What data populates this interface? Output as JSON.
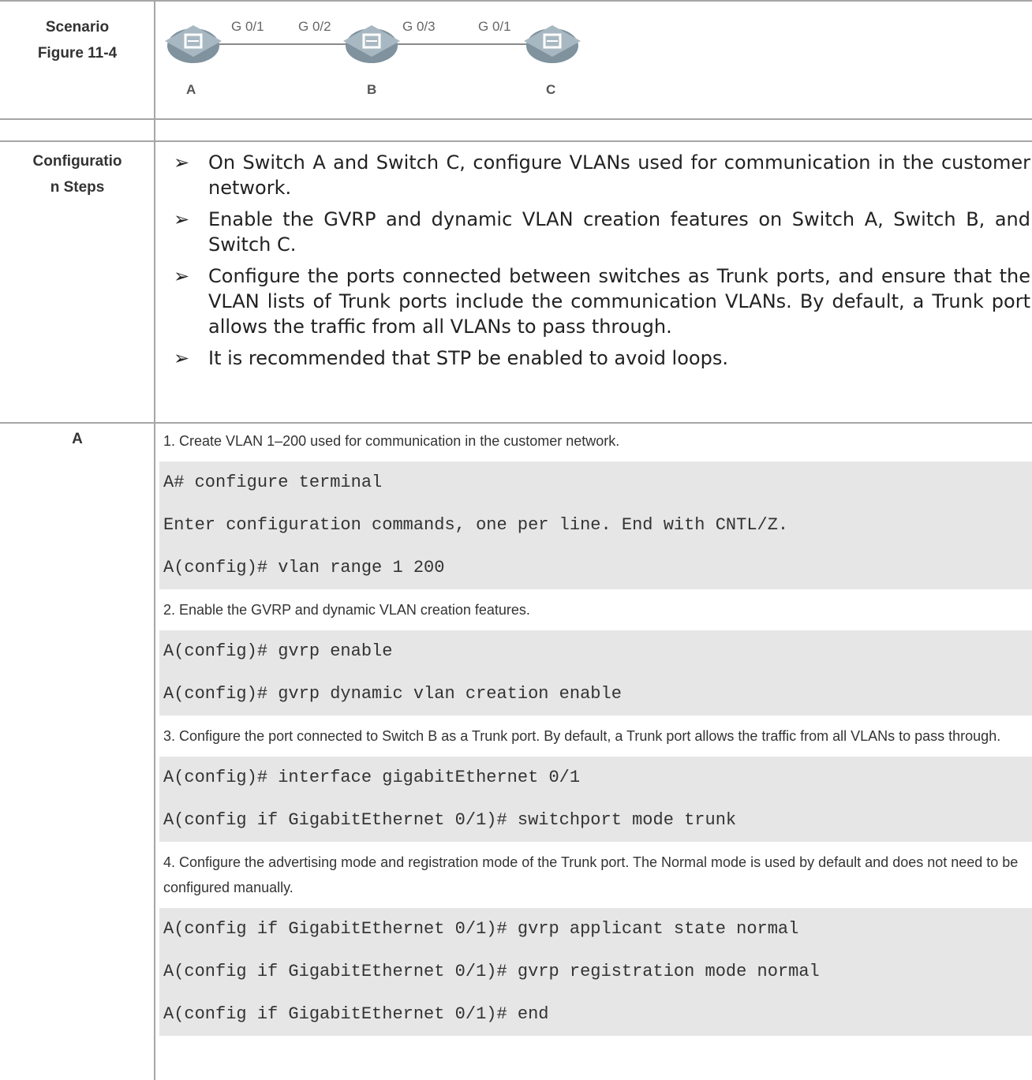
{
  "scenario": {
    "label_line1": "Scenario",
    "label_line2": "Figure 11-4",
    "devices": [
      "A",
      "B",
      "C"
    ],
    "ports": [
      "G 0/1",
      "G 0/2",
      "G 0/3",
      "G 0/1"
    ]
  },
  "config": {
    "label_line1": "Configuratio",
    "label_line2": "n Steps",
    "bullet": "➢",
    "steps": [
      "On Switch A and Switch C, configure VLANs used for communication in the customer network.",
      "Enable the GVRP and dynamic VLAN creation features on Switch A, Switch B, and Switch C.",
      "Configure the ports connected between switches as Trunk ports, and ensure that the VLAN lists of Trunk ports include the communication VLANs. By default, a Trunk port allows the traffic from all VLANs to pass through.",
      "It is recommended that STP be enabled to avoid loops."
    ]
  },
  "device_a": {
    "label": "A",
    "blocks": [
      {
        "note": "1. Create VLAN 1–200 used for communication in the customer network.",
        "lines": [
          "A# configure terminal",
          "Enter configuration commands, one per line. End with CNTL/Z.",
          "A(config)# vlan range 1 200"
        ]
      },
      {
        "note": "2. Enable the GVRP and dynamic VLAN creation features.",
        "lines": [
          "A(config)# gvrp enable",
          "A(config)# gvrp dynamic vlan creation enable"
        ]
      },
      {
        "note": "3. Configure the port connected to Switch B as a Trunk port. By default, a Trunk port allows the traffic from all VLANs to pass through.",
        "lines": [
          "A(config)# interface gigabitEthernet 0/1",
          "A(config if GigabitEthernet 0/1)# switchport mode trunk"
        ]
      },
      {
        "note": "4. Configure the advertising mode and registration mode of the Trunk port. The Normal mode is used by default and does not need to be configured manually.",
        "lines": [
          "A(config if GigabitEthernet 0/1)# gvrp applicant state normal",
          "A(config if GigabitEthernet 0/1)# gvrp registration mode normal",
          "A(config if GigabitEthernet 0/1)# end"
        ]
      }
    ]
  },
  "colors": {
    "border": "#a6a6a6",
    "code_bg": "#e6e6e6",
    "switch_top": "#a8b8c2",
    "switch_side": "#7f929e"
  }
}
